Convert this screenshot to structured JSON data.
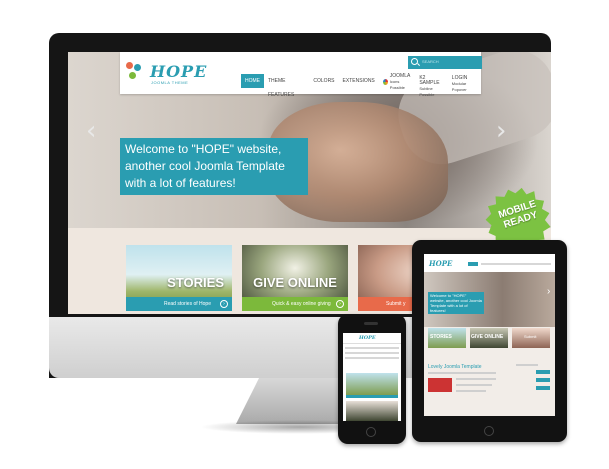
{
  "logo": {
    "name": "HOPE",
    "tagline": "JOOMLA THEME"
  },
  "nav": {
    "items": [
      {
        "label": "HOME",
        "active": true
      },
      {
        "label": "THEME FEATURES"
      },
      {
        "label": "COLORS"
      },
      {
        "label": "EXTENSIONS"
      }
    ],
    "joomla": {
      "label": "JOOMLA",
      "sub": "Icons Possible"
    },
    "k2": {
      "label": "K2 SAMPLE",
      "sub": "Subline Possible"
    },
    "login": {
      "label": "LOGIN",
      "sub": "Modular Popover"
    }
  },
  "search": {
    "placeholder": "SEARCH"
  },
  "slide": {
    "caption": "Welcome to \"HOPE\" website, another cool Joomla Template with a lot of features!"
  },
  "cards": [
    {
      "title": "STORIES",
      "subtitle": "Read stories of Hope",
      "color": "#2a9db1"
    },
    {
      "title": "GIVE ONLINE",
      "subtitle": "Quick & easy online giving",
      "color": "#7cb93b"
    },
    {
      "title": "",
      "subtitle": "Submit y",
      "color": "#e86a4a"
    }
  ],
  "badge": {
    "line1": "MOBILE",
    "line2": "READY"
  },
  "ipad": {
    "caption": "Welcome to \"HOPE\" website, another cool Joomla Template with a lot of features!",
    "cards": [
      "STORIES",
      "GIVE ONLINE",
      "Submit"
    ],
    "heading": "Lovely Joomla Template"
  },
  "colors": {
    "accent": "#2a9db1",
    "green": "#7cc242"
  }
}
